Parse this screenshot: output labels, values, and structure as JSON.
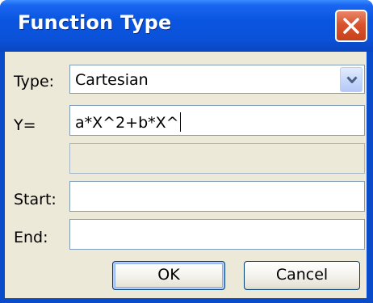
{
  "window": {
    "title": "Function Type"
  },
  "form": {
    "type_label": "Type:",
    "type_value": "Cartesian",
    "y_label": "Y=",
    "y_value": "a*X^2+b*X^",
    "extra_value": "",
    "start_label": "Start:",
    "start_value": "",
    "end_label": "End:",
    "end_value": ""
  },
  "buttons": {
    "ok_label": "OK",
    "cancel_label": "Cancel"
  },
  "icons": {
    "close": "close-icon",
    "dropdown": "chevron-down-icon"
  },
  "colors": {
    "titlebar": "#0a55e0",
    "close_button": "#d9542c",
    "dialog_background": "#ece9d8",
    "field_border": "#7f9db9"
  }
}
